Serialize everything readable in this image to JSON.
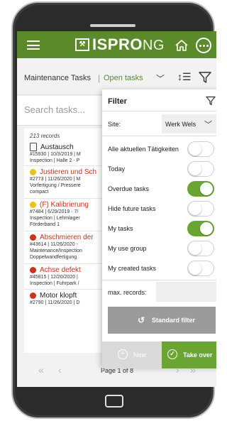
{
  "app": {
    "logo_text": "ISPRO",
    "logo_suffix": "NG",
    "logo_box": "⚒"
  },
  "breadcrumb": {
    "main": "Maintenance Tasks",
    "separator": "|",
    "sub": "Open tasks"
  },
  "search": {
    "placeholder": "Search tasks..."
  },
  "list": {
    "records": "213 records",
    "items": [
      {
        "title": "Austausch",
        "status": "none",
        "l1": "#15930 | 10/3/2019 | M",
        "l2": "Inspection | Halle 2 - P",
        "l3": ""
      },
      {
        "title": "Justieren und Sch",
        "status": "yellow",
        "l1": "#2773 | 11/26/2020 | M",
        "l2": "Vorfertigung / Pressere",
        "l3": "compact"
      },
      {
        "title": "(F) Kalibrierung",
        "status": "yellow",
        "l1": "#7484 | 6/29/2019 - 7/",
        "l2": "Inspection | Lehmlager",
        "l3": "Förderband 1"
      },
      {
        "title": "Abschmieren der",
        "status": "red",
        "l1": "#43614 | 11/26/2020 -",
        "l2": "Maintenance/Inspection",
        "l3": "Doppelwandfertigung"
      },
      {
        "title": "Achse defekt",
        "status": "red",
        "l1": "#45815 | 12/20/2020 |",
        "l2": "Inspection | Fuhrpark /",
        "l3": ""
      },
      {
        "title": "Motor klopft",
        "status": "red",
        "l1": "#2790 | 11/26/2020 | D",
        "l2": "",
        "l3": ""
      }
    ],
    "pager": {
      "first": "«",
      "prev": "‹",
      "label": "Page 1 of 8",
      "next": "›",
      "last": "»"
    }
  },
  "filter": {
    "title": "Filter",
    "site_label": "Site:",
    "site_value": "Werk Wels",
    "options": [
      {
        "label": "Alle aktuellen Tätigkeiten",
        "on": false
      },
      {
        "label": "Today",
        "on": false
      },
      {
        "label": "Overdue tasks",
        "on": true
      },
      {
        "label": "Hide future tasks",
        "on": false
      },
      {
        "label": "My tasks",
        "on": true
      },
      {
        "label": "My use group",
        "on": false
      },
      {
        "label": "My created tasks",
        "on": false
      }
    ],
    "max_label": "max. records:",
    "max_value": "",
    "standard_filter": "Standard filter",
    "new_label": "New",
    "takeover_label": "Take over"
  },
  "colors": {
    "brand_green": "#5a8a2a",
    "toggle_on": "#6aa534",
    "status_red": "#c8341d",
    "status_yellow": "#e8c51a"
  }
}
